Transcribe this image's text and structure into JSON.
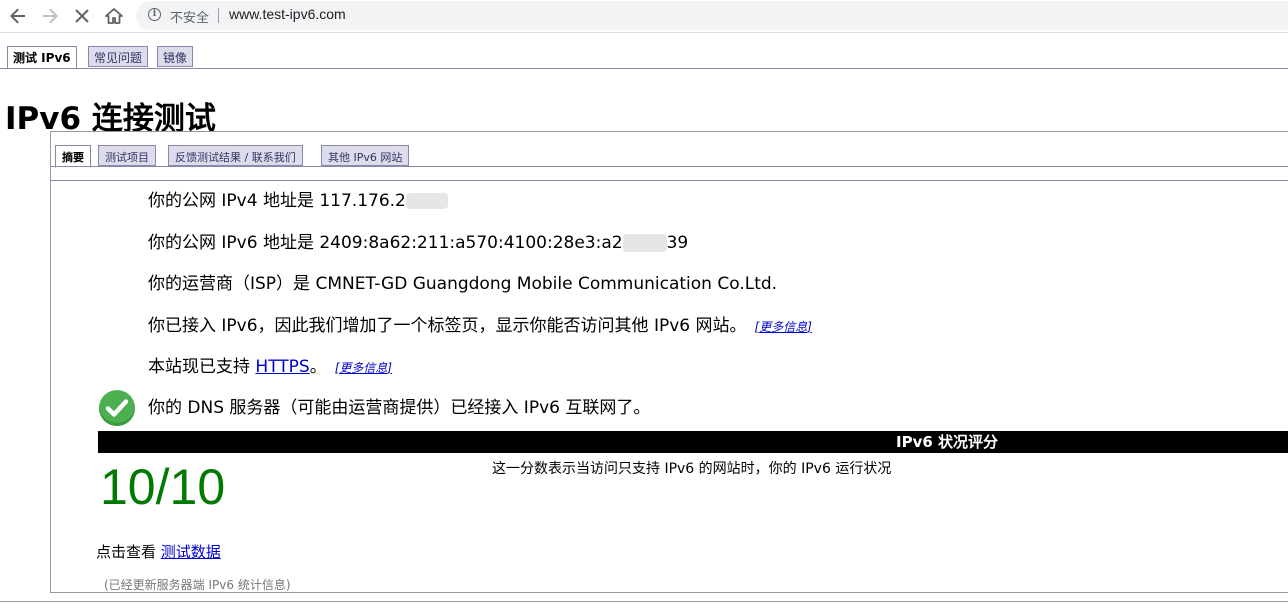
{
  "browser": {
    "insecure_label": "不安全",
    "url": "www.test-ipv6.com"
  },
  "top_tabs": [
    "测试 IPv6",
    "常见问题",
    "镜像"
  ],
  "page_title": "IPv6 连接测试",
  "sub_tabs": [
    "摘要",
    "测试项目",
    "反馈测试结果 / 联系我们",
    "其他 IPv6 网站"
  ],
  "summary": {
    "ipv4_prefix": "你的公网 IPv4 地址是 117.176.2",
    "ipv4_suffix": "",
    "ipv6_prefix": "你的公网 IPv6 地址是 2409:8a62:211:a570:4100:28e3:a2",
    "ipv6_suffix": "39",
    "isp": "你的运营商（ISP）是 CMNET-GD Guangdong Mobile Communication Co.Ltd.",
    "ipv6_tab_note": "你已接入 IPv6，因此我们增加了一个标签页，显示你能否访问其他 IPv6 网站。",
    "more_info": "更多信息",
    "https_prefix": "本站现已支持 ",
    "https_link": "HTTPS",
    "https_suffix": "。",
    "dns_note": "你的 DNS 服务器（可能由运营商提供）已经接入 IPv6 互联网了。"
  },
  "score": {
    "header": "IPv6 状况评分",
    "value": "10/10",
    "description": "这一分数表示当访问只支持 IPv6 的网站时，你的 IPv6 运行状况"
  },
  "footer": {
    "click_view_prefix": "点击查看 ",
    "test_data_link": "测试数据",
    "updated_note": "(已经更新服务器端 IPv6 统计信息)"
  },
  "colors": {
    "score_green": "#007a00",
    "link_blue": "#0000cc",
    "check_green": "#4caf50"
  }
}
